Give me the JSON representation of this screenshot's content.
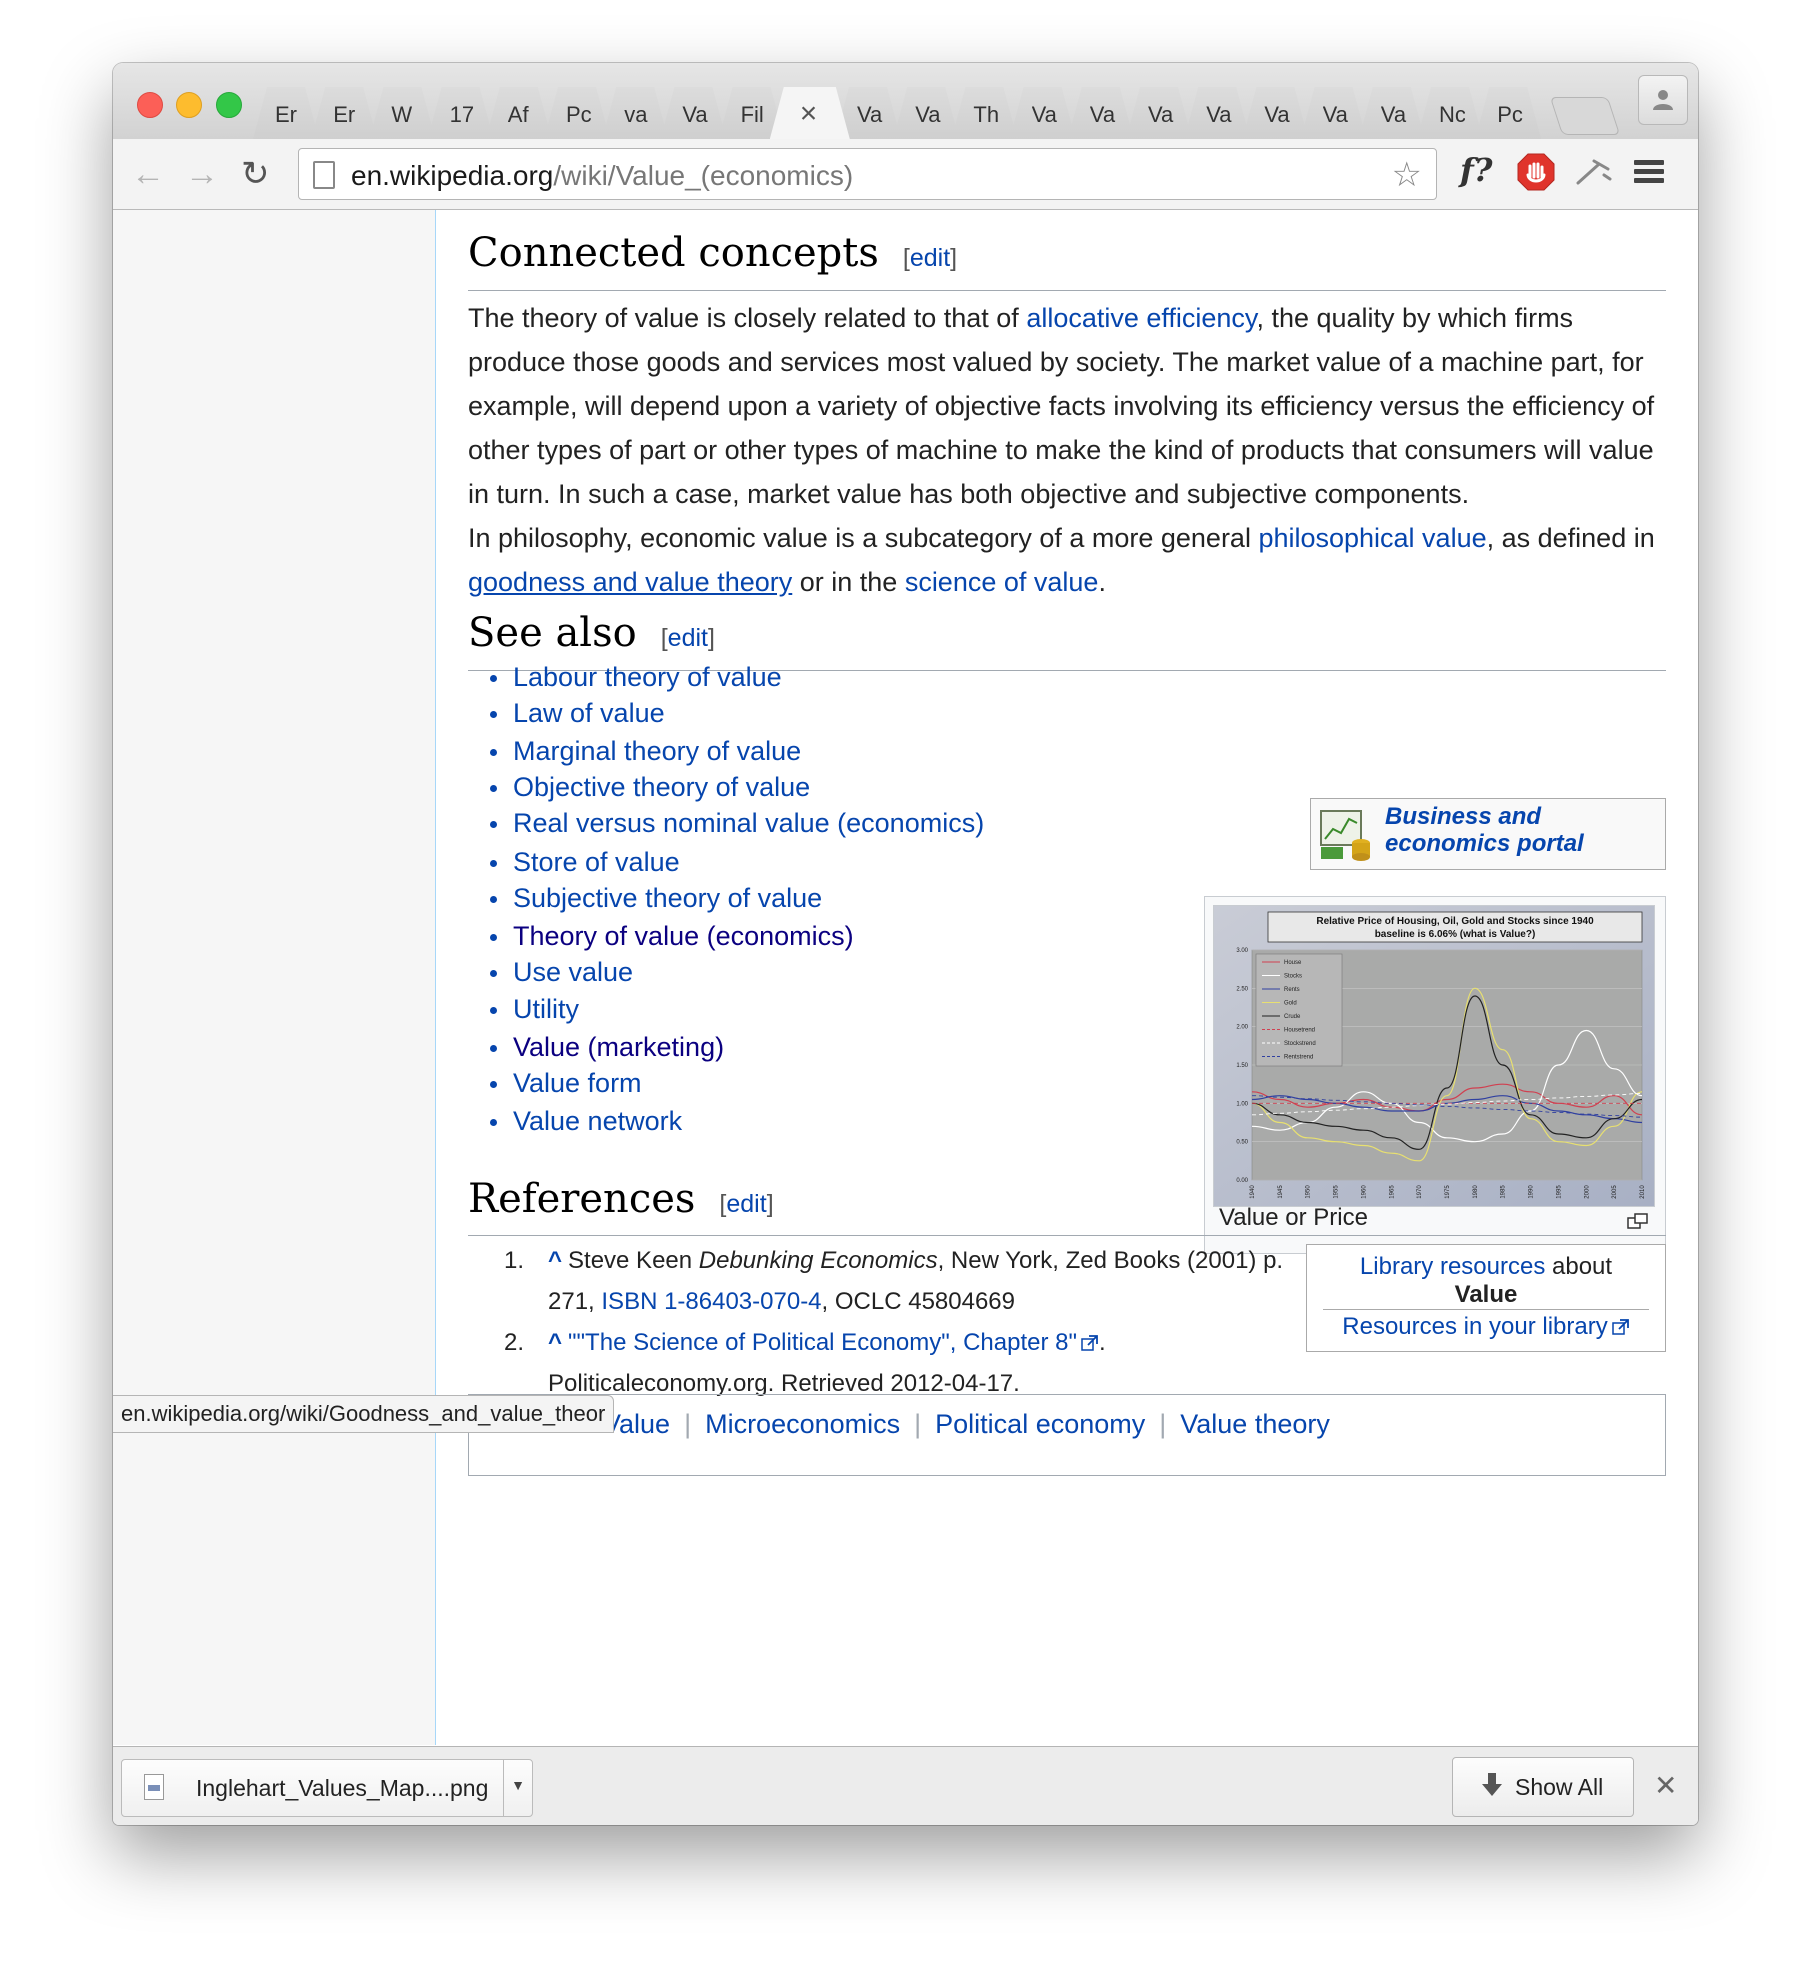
{
  "window": {
    "tabs": [
      {
        "label": "Er"
      },
      {
        "label": "Er"
      },
      {
        "label": "W"
      },
      {
        "label": "17"
      },
      {
        "label": "Af"
      },
      {
        "label": "Pc"
      },
      {
        "label": "va"
      },
      {
        "label": "Va"
      },
      {
        "label": "Fil"
      },
      {
        "label": "×",
        "active": true
      },
      {
        "label": "Va"
      },
      {
        "label": "Va"
      },
      {
        "label": "Th"
      },
      {
        "label": "Va"
      },
      {
        "label": "Va"
      },
      {
        "label": "Va"
      },
      {
        "label": "Va"
      },
      {
        "label": "Va"
      },
      {
        "label": "Va"
      },
      {
        "label": "Va"
      },
      {
        "label": "Nc"
      },
      {
        "label": "Pc"
      }
    ]
  },
  "toolbar": {
    "url_host": "en.wikipedia.org",
    "url_path": "/wiki/Value_(economics)",
    "ext_f": "f?"
  },
  "sections": {
    "connected": {
      "title": "Connected concepts",
      "edit": "edit",
      "p1": [
        {
          "t": "The theory of value is closely related to that of "
        },
        {
          "t": "allocative efficiency",
          "link": true
        },
        {
          "t": ", the quality by which firms produce those goods and services most valued by society. The market value of a machine part, for example, will depend upon a variety of objective facts involving its efficiency versus the efficiency of other types of part or other types of machine to make the kind of products that consumers will value in turn. In such a case, market value has both objective and subjective components."
        }
      ],
      "p2": [
        {
          "t": "In philosophy, economic value is a subcategory of a more general "
        },
        {
          "t": "philosophical value",
          "link": true
        },
        {
          "t": ", as defined in "
        },
        {
          "t": "goodness and value theory",
          "link": true,
          "underline": true
        },
        {
          "t": " or in the "
        },
        {
          "t": "science of value",
          "link": true
        },
        {
          "t": "."
        }
      ]
    },
    "seealso": {
      "title": "See also",
      "edit": "edit",
      "items": [
        {
          "label": "Labour theory of value"
        },
        {
          "label": "Law of value"
        },
        {
          "label": "Marginal theory of value"
        },
        {
          "label": "Objective theory of value"
        },
        {
          "label": "Real versus nominal value (economics)"
        },
        {
          "label": "Store of value"
        },
        {
          "label": "Subjective theory of value"
        },
        {
          "label": "Theory of value (economics)",
          "visited": true
        },
        {
          "label": "Use value"
        },
        {
          "label": "Utility"
        },
        {
          "label": "Value (marketing)",
          "visited": true
        },
        {
          "label": "Value form"
        },
        {
          "label": "Value network"
        }
      ],
      "portal": "Business and economics portal",
      "thumb_caption": "Value or Price"
    },
    "references": {
      "title": "References",
      "edit": "edit",
      "items": [
        {
          "num": "1.",
          "caret": "^",
          "text_a": "Steve Keen ",
          "italic": "Debunking Economics",
          "text_b": ", New York, Zed Books (2001) p. 271, ",
          "link": "ISBN 1-86403-070-4",
          "text_c": ", OCLC 45804669"
        },
        {
          "num": "2.",
          "caret": "^",
          "link": "\"\"The Science of Political Economy\", Chapter 8\"",
          "text_a": ". Politicaleconomy.org. Retrieved 2012-04-17."
        }
      ],
      "library": {
        "line1_link": "Library resources",
        "line1_text": " about",
        "subject": "Value",
        "line2": "Resources in your library"
      }
    }
  },
  "categories": [
    "Value",
    "Microeconomics",
    "Political economy",
    "Value theory"
  ],
  "status_url": "en.wikipedia.org/wiki/Goodness_and_value_theor",
  "download": {
    "filename": "Inglehart_Values_Map....png",
    "show_all": "Show All"
  },
  "chart_data": {
    "type": "line",
    "title": "Relative Price of Housing, Oil, Gold and Stocks since 1940",
    "subtitle": "baseline is 6.06% (what is Value?)",
    "x": [
      1940,
      1945,
      1950,
      1955,
      1960,
      1965,
      1970,
      1975,
      1980,
      1985,
      1990,
      1995,
      2000,
      2005,
      2010
    ],
    "ylim": [
      0,
      3.0
    ],
    "yticks": [
      "0.00",
      "0.50",
      "1.00",
      "1.50",
      "2.00",
      "2.50",
      "3.00"
    ],
    "legend": [
      "House",
      "Stocks",
      "Rents",
      "Gold",
      "Crude",
      "Housetrend",
      "Stockstrend",
      "Rentstrend"
    ],
    "series": [
      {
        "name": "House",
        "color": "#d04050",
        "values": [
          1.15,
          1.05,
          0.95,
          1.0,
          1.05,
          0.95,
          0.9,
          1.05,
          1.2,
          1.25,
          1.15,
          1.0,
          0.95,
          1.1,
          0.85
        ]
      },
      {
        "name": "Stocks",
        "color": "#ffffff",
        "values": [
          0.7,
          0.65,
          0.75,
          0.95,
          1.15,
          1.0,
          0.75,
          0.55,
          0.5,
          0.6,
          0.9,
          1.5,
          1.95,
          1.45,
          1.1
        ]
      },
      {
        "name": "Rents",
        "color": "#3040a0",
        "values": [
          1.05,
          1.1,
          1.05,
          1.0,
          0.95,
          0.9,
          0.9,
          1.0,
          1.05,
          1.1,
          1.0,
          0.9,
          0.85,
          0.8,
          0.75
        ]
      },
      {
        "name": "Gold",
        "color": "#e8e070",
        "values": [
          1.0,
          0.75,
          0.55,
          0.5,
          0.45,
          0.35,
          0.25,
          1.1,
          2.5,
          1.7,
          0.8,
          0.5,
          0.45,
          0.7,
          1.15
        ]
      },
      {
        "name": "Crude",
        "color": "#222222",
        "values": [
          1.0,
          0.85,
          0.75,
          0.7,
          0.65,
          0.55,
          0.4,
          1.2,
          2.4,
          1.5,
          0.85,
          0.6,
          0.55,
          0.8,
          1.05
        ]
      },
      {
        "name": "Housetrend",
        "color": "#d04050",
        "dash": true,
        "values": [
          1.0,
          1.0,
          1.0,
          1.0,
          1.0,
          1.0,
          1.0,
          1.0,
          1.0,
          1.0,
          1.0,
          1.0,
          1.0,
          1.0,
          1.0
        ]
      },
      {
        "name": "Stockstrend",
        "color": "#ffffff",
        "dash": true,
        "values": [
          0.85,
          0.87,
          0.89,
          0.91,
          0.93,
          0.95,
          0.97,
          0.99,
          1.01,
          1.03,
          1.05,
          1.07,
          1.09,
          1.11,
          1.13
        ]
      },
      {
        "name": "Rentstrend",
        "color": "#3040a0",
        "dash": true,
        "values": [
          1.1,
          1.08,
          1.06,
          1.04,
          1.02,
          1.0,
          0.98,
          0.96,
          0.94,
          0.92,
          0.9,
          0.88,
          0.86,
          0.84,
          0.82
        ]
      }
    ]
  }
}
